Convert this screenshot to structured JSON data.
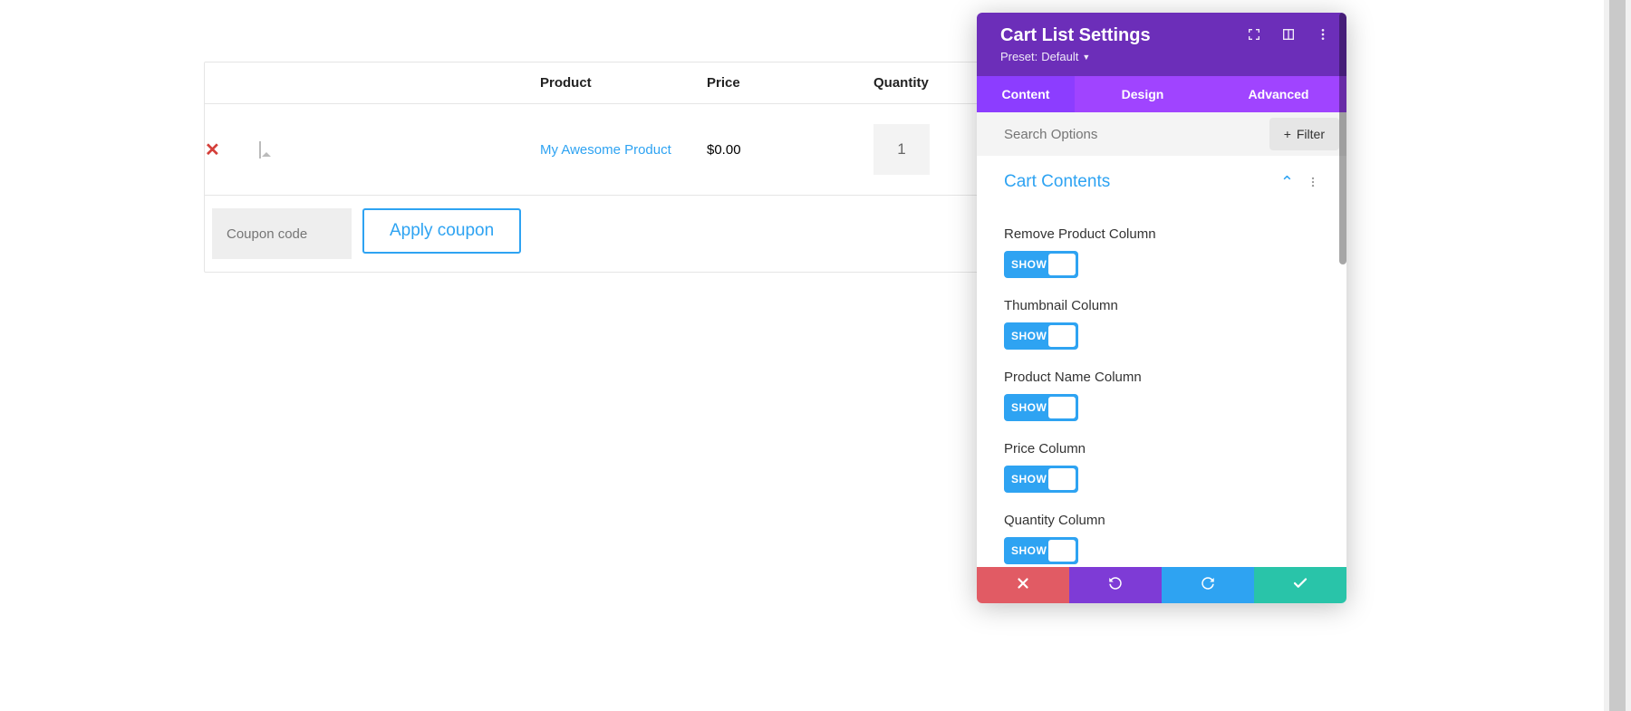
{
  "cart": {
    "headers": {
      "product": "Product",
      "price": "Price",
      "quantity": "Quantity"
    },
    "items": [
      {
        "name": "My Awesome Product",
        "price": "$0.00",
        "qty": "1"
      }
    ],
    "coupon_placeholder": "Coupon code",
    "apply_label": "Apply coupon"
  },
  "panel": {
    "title": "Cart List Settings",
    "preset_prefix": "Preset: ",
    "preset_value": "Default",
    "tabs": {
      "content": "Content",
      "design": "Design",
      "advanced": "Advanced"
    },
    "search_placeholder": "Search Options",
    "filter_label": "Filter",
    "section_title": "Cart Contents",
    "options": [
      {
        "label": "Remove Product Column",
        "state": "SHOW"
      },
      {
        "label": "Thumbnail Column",
        "state": "SHOW"
      },
      {
        "label": "Product Name Column",
        "state": "SHOW"
      },
      {
        "label": "Price Column",
        "state": "SHOW"
      },
      {
        "label": "Quantity Column",
        "state": "SHOW"
      }
    ]
  }
}
